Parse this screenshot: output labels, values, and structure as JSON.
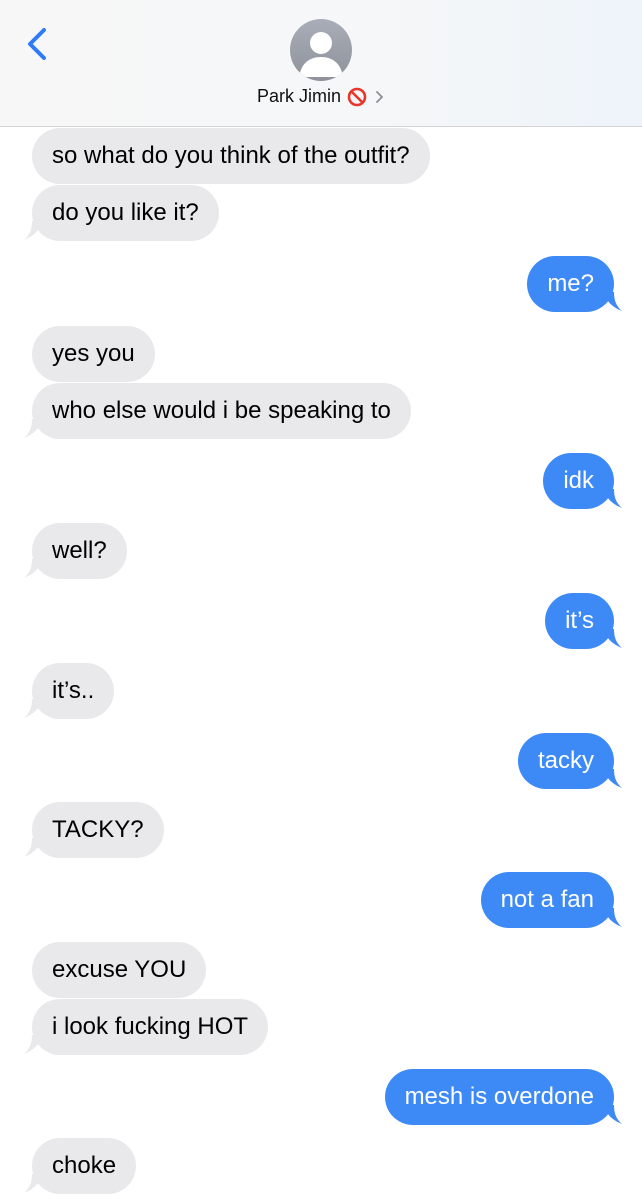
{
  "header": {
    "contact_name": "Park Jimin",
    "back_icon": "chevron-left-icon",
    "avatar_icon": "person-silhouette-icon",
    "status_icon": "blocked-icon",
    "detail_icon": "chevron-right-icon"
  },
  "colors": {
    "received_bubble": "#e9e9eb",
    "sent_bubble": "#3d8af7",
    "ios_blue": "#2f7cf6",
    "blocked_red": "#e8372a"
  },
  "messages": [
    {
      "side": "received",
      "text": "so what do you think of the outfit?"
    },
    {
      "side": "received",
      "text": "do you like it?"
    },
    {
      "side": "sent",
      "text": "me?"
    },
    {
      "side": "received",
      "text": "yes you"
    },
    {
      "side": "received",
      "text": "who else would i be speaking to"
    },
    {
      "side": "sent",
      "text": "idk"
    },
    {
      "side": "received",
      "text": "well?"
    },
    {
      "side": "sent",
      "text": "it’s"
    },
    {
      "side": "received",
      "text": "it’s.."
    },
    {
      "side": "sent",
      "text": "tacky"
    },
    {
      "side": "received",
      "text": "TACKY?"
    },
    {
      "side": "sent",
      "text": "not a fan"
    },
    {
      "side": "received",
      "text": "excuse YOU"
    },
    {
      "side": "received",
      "text": "i look fucking HOT"
    },
    {
      "side": "sent",
      "text": "mesh is overdone"
    },
    {
      "side": "received",
      "text": "choke"
    }
  ]
}
